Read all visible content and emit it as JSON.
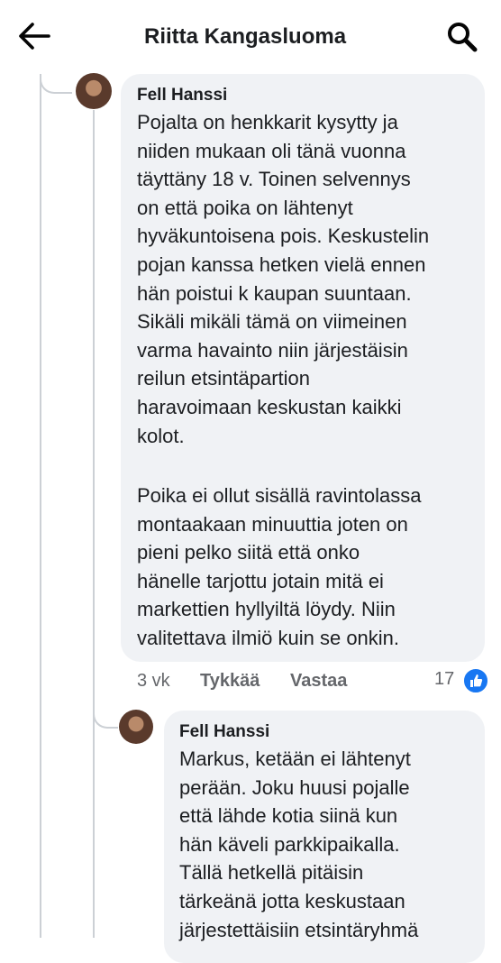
{
  "header": {
    "title": "Riitta Kangasluoma"
  },
  "comments": [
    {
      "author": "Fell Hanssi",
      "paragraphs": [
        "Pojalta on henkkarit kysytty ja\nniiden mukaan oli tänä vuonna\ntäyttäny 18 v. Toinen selvennys\non että poika on lähtenyt\nhyväkuntoisena pois. Keskustelin\npojan kanssa hetken vielä ennen\nhän poistui k kaupan suuntaan.\nSikäli mikäli tämä on viimeinen\nvarma havainto niin järjestäisin\nreilun etsintäpartion\nharavoimaan keskustan kaikki\nkolot.",
        "Poika ei ollut sisällä ravintolassa\nmontaakaan minuuttia joten on\npieni pelko siitä että onko\nhänelle tarjottu jotain mitä ei\nmarkettien hyllyiltä löydy. Niin\nvalitettava ilmiö kuin se onkin."
      ],
      "time": "3 vk",
      "like_label": "Tykkää",
      "reply_label": "Vastaa",
      "reaction_count": "17"
    },
    {
      "author": "Fell Hanssi",
      "text": "Markus, ketään ei lähtenyt\nperään. Joku huusi pojalle\nettä lähde kotia siinä kun\nhän käveli parkkipaikalla.\nTällä hetkellä pitäisin\ntärkeänä jotta keskustaan\njärjestettäisiin etsintäryhmä"
    }
  ],
  "icons": {
    "back": "arrow-left-icon",
    "search": "search-icon",
    "reaction": "thumbs-up-icon"
  },
  "colors": {
    "bubble": "#f0f2f5",
    "meta": "#65676b",
    "accent": "#1877f2"
  }
}
